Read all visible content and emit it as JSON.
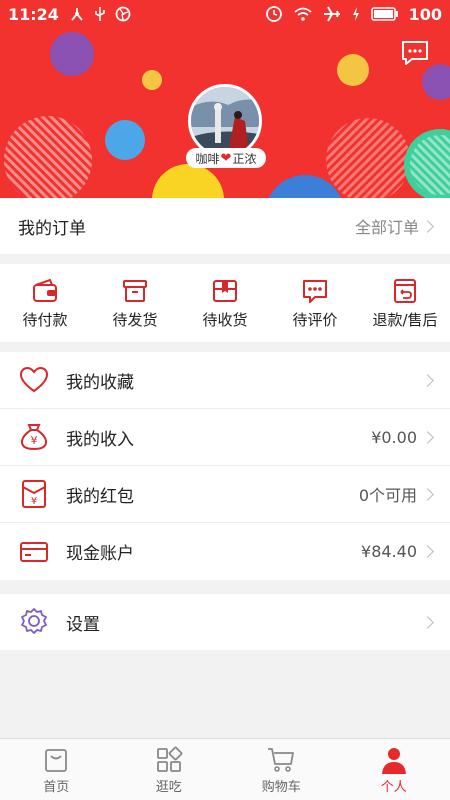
{
  "status_bar": {
    "time": "11:24",
    "battery": "100"
  },
  "header": {
    "nickname_left": "咖啡",
    "nickname_right": "正浓",
    "heart": "❤"
  },
  "orders": {
    "title": "我的订单",
    "all_label": "全部订单",
    "items": [
      {
        "label": "待付款",
        "icon": "wallet-icon"
      },
      {
        "label": "待发货",
        "icon": "box-icon"
      },
      {
        "label": "待收货",
        "icon": "package-icon"
      },
      {
        "label": "待评价",
        "icon": "comment-icon"
      },
      {
        "label": "退款/售后",
        "icon": "refund-icon"
      }
    ]
  },
  "menu": [
    {
      "label": "我的收藏",
      "value": "",
      "icon": "heart-icon"
    },
    {
      "label": "我的收入",
      "value": "¥0.00",
      "icon": "money-bag-icon"
    },
    {
      "label": "我的红包",
      "value": "0个可用",
      "icon": "red-envelope-icon"
    },
    {
      "label": "现金账户",
      "value": "¥84.40",
      "icon": "card-icon"
    }
  ],
  "settings": {
    "label": "设置"
  },
  "bottom_nav": [
    {
      "label": "首页",
      "icon": "bag-icon",
      "active": false
    },
    {
      "label": "逛吃",
      "icon": "grid-icon",
      "active": false
    },
    {
      "label": "购物车",
      "icon": "cart-icon",
      "active": false
    },
    {
      "label": "个人",
      "icon": "person-icon",
      "active": true
    }
  ],
  "colors": {
    "brand": "#f1322e",
    "accent": "#e8292b",
    "icon_outline": "#d7282b"
  }
}
